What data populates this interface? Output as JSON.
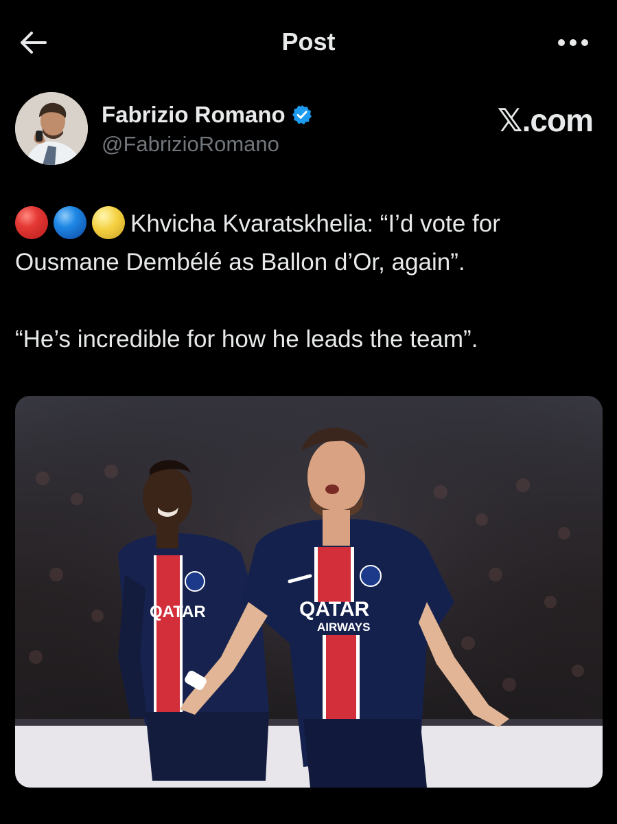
{
  "header": {
    "title": "Post",
    "back_icon": "arrow-left-icon",
    "more_icon": "ellipsis-icon"
  },
  "author": {
    "name": "Fabrizio Romano",
    "handle": "@FabrizioRomano",
    "verified_icon": "verified-badge-icon",
    "verified_color": "#1d9bf0"
  },
  "watermark": "𝕏.com",
  "tweet": {
    "emojis": [
      "red-circle",
      "blue-circle",
      "yellow-moon"
    ],
    "line1": "Khvicha Kvaratskhelia: “I’d vote for Ousmane Dembélé as Ballon d’Or, again”.",
    "line2": "“He’s incredible for how he leads the team”."
  },
  "media": {
    "jersey_sponsor": "QATAR",
    "jersey_sponsor_sub": "AIRWAYS"
  },
  "colors": {
    "background": "#000000",
    "text": "#e7e9ea",
    "secondary_text": "#71767b",
    "accent": "#1d9bf0"
  }
}
